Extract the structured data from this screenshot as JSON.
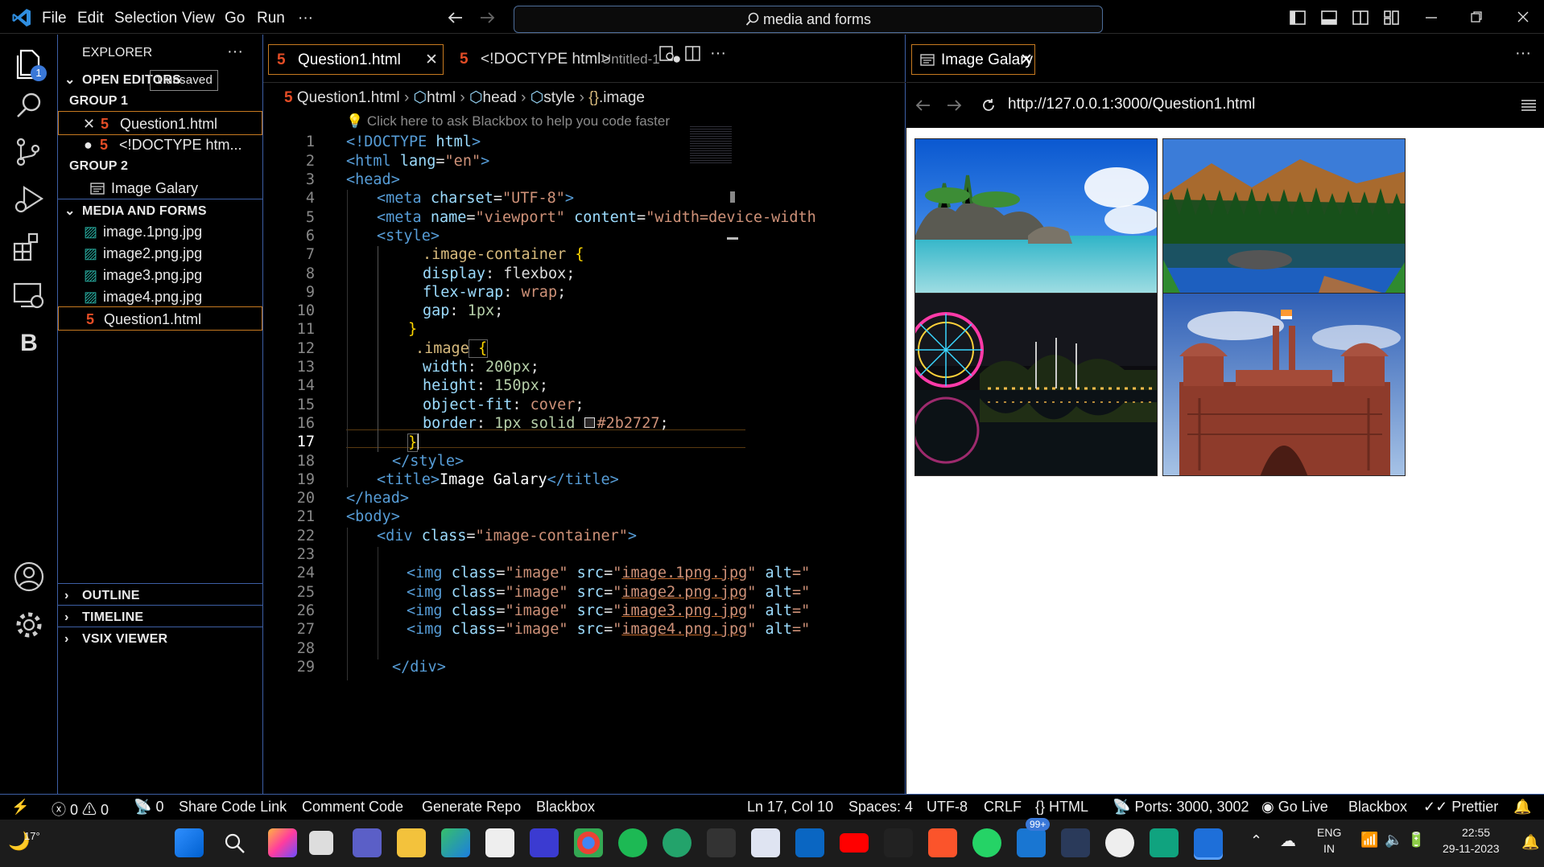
{
  "menu": [
    "File",
    "Edit",
    "Selection",
    "View",
    "Go",
    "Run",
    "···"
  ],
  "search": {
    "text": "media and forms"
  },
  "activity": {
    "badge": "1",
    "letter": "B"
  },
  "explorer": {
    "title": "EXPLORER",
    "more": "···",
    "open_editors": "OPEN EDITORS",
    "unsaved": "1 unsaved",
    "group1": "GROUP 1",
    "group2": "GROUP 2",
    "open_files": [
      "Question1.html",
      "<!DOCTYPE htm..."
    ],
    "group2_file": "Image Galary",
    "folder": "MEDIA AND FORMS",
    "files": [
      "image.1png.jpg",
      "image2.png.jpg",
      "image3.png.jpg",
      "image4.png.jpg",
      "Question1.html"
    ],
    "outline": "OUTLINE",
    "timeline": "TIMELINE",
    "vsix": "VSIX VIEWER"
  },
  "editor": {
    "tab1": "Question1.html",
    "tab2": "<!DOCTYPE html>",
    "tab2_desc": "Untitled-1",
    "breadcrumb": [
      "Question1.html",
      "html",
      "head",
      "style",
      ".image"
    ],
    "hint": "Click here to ask Blackbox to help you code faster",
    "line_numbers": [
      "1",
      "2",
      "3",
      "4",
      "5",
      "6",
      "7",
      "8",
      "9",
      "10",
      "11",
      "12",
      "13",
      "14",
      "15",
      "16",
      "17",
      "18",
      "19",
      "20",
      "21",
      "22",
      "23",
      "24",
      "25",
      "26",
      "27",
      "28",
      "29"
    ]
  },
  "code": {
    "l1": [
      "<!DOCTYPE",
      " html",
      ">"
    ],
    "l2": [
      "<html",
      " lang",
      "=",
      "\"en\"",
      ">"
    ],
    "l3": [
      "<head>"
    ],
    "l4": [
      "<meta",
      " charset",
      "=",
      "\"UTF-8\"",
      ">"
    ],
    "l5": [
      "<meta",
      " name",
      "=",
      "\"viewport\"",
      " content",
      "=",
      "\"width=device-width"
    ],
    "l6": [
      "<style>"
    ],
    "l7": [
      ".image-container",
      " {"
    ],
    "l8": [
      "display",
      ": ",
      "flexbox",
      ";"
    ],
    "l9": [
      "flex-wrap",
      ": ",
      "wrap",
      ";"
    ],
    "l10": [
      "gap",
      ": ",
      "1px",
      ";"
    ],
    "l11": [
      "}"
    ],
    "l12": [
      ".image",
      " {"
    ],
    "l13": [
      "width",
      ": ",
      "200px",
      ";"
    ],
    "l14": [
      "height",
      ": ",
      "150px",
      ";"
    ],
    "l15": [
      "object-fit",
      ": ",
      "cover",
      ";"
    ],
    "l16": [
      "border",
      ": ",
      "1px solid ",
      "#2b2727",
      ";"
    ],
    "l17": [
      "}"
    ],
    "l18": [
      "</style>"
    ],
    "l19": [
      "<title>",
      "Image Galary",
      "</title>"
    ],
    "l20": [
      "</head>"
    ],
    "l21": [
      "<body>"
    ],
    "l22": [
      "<div",
      " class",
      "=",
      "\"image-container\"",
      ">"
    ],
    "l24": [
      "<img",
      " class",
      "=",
      "\"image\"",
      " src",
      "=",
      "\"",
      "image.1png.jpg",
      "\"",
      " alt",
      "=\""
    ],
    "l25": [
      "<img",
      " class",
      "=",
      "\"image\"",
      " src",
      "=",
      "\"",
      "image2.png.jpg",
      "\"",
      " alt",
      "=\""
    ],
    "l26": [
      "<img",
      " class",
      "=",
      "\"image\"",
      " src",
      "=",
      "\"",
      "image3.png.jpg",
      "\"",
      " alt",
      "=\""
    ],
    "l27": [
      "<img",
      " class",
      "=",
      "\"image\"",
      " src",
      "=",
      "\"",
      "image4.png.jpg",
      "\"",
      " alt",
      "=\""
    ],
    "l29": [
      "</div>"
    ]
  },
  "preview": {
    "tab": "Image Galary",
    "url": "http://127.0.0.1:3000/Question1.html",
    "images": [
      "beach",
      "mountain lake",
      "night fair",
      "red fort"
    ]
  },
  "status": {
    "errors": "0",
    "warnings": "0",
    "ports_count": "0",
    "items": [
      "Share Code Link",
      "Comment Code",
      "Generate Repo",
      "Blackbox"
    ],
    "position": "Ln 17, Col 10",
    "spaces": "Spaces: 4",
    "encoding": "UTF-8",
    "eol": "CRLF",
    "lang": "HTML",
    "ports": "Ports: 3000, 3002",
    "golive": "Go Live",
    "blackbox": "Blackbox",
    "prettier": "Prettier"
  },
  "taskbar": {
    "temp": "17°",
    "badge": "99+",
    "lang": "ENG",
    "region": "IN",
    "time": "22:55",
    "date": "29-11-2023"
  },
  "colors": {
    "accent": "#3d5fa5",
    "html_icon": "#e44d26",
    "cursor_line": "#c77a20"
  }
}
